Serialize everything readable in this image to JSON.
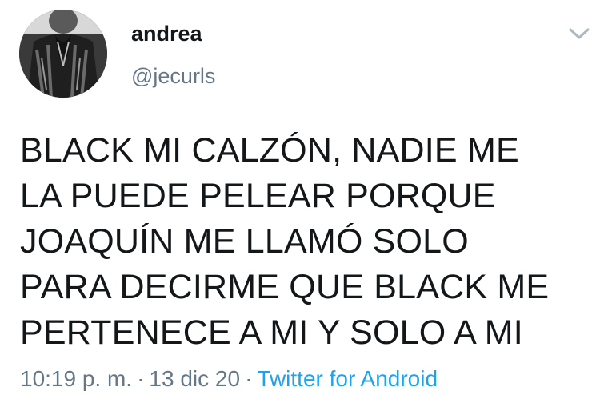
{
  "user": {
    "display_name": "andrea",
    "handle": "@jecurls"
  },
  "tweet": {
    "lines": [
      "BLACK MI CALZÓN, NADIE ME",
      "LA PUEDE PELEAR PORQUE",
      "JOAQUÍN ME LLAMÓ SOLO",
      "PARA DECIRME QUE BLACK ME",
      "PERTENECE A MI Y SOLO A MI"
    ],
    "time": "10:19 p. m.",
    "separator": "·",
    "date": "13 dic 20",
    "source": "Twitter for Android"
  },
  "icons": {
    "menu": "chevron-down-icon"
  },
  "colors": {
    "link": "#1da1f2",
    "secondary_text": "#657786",
    "primary_text": "#14171a"
  }
}
